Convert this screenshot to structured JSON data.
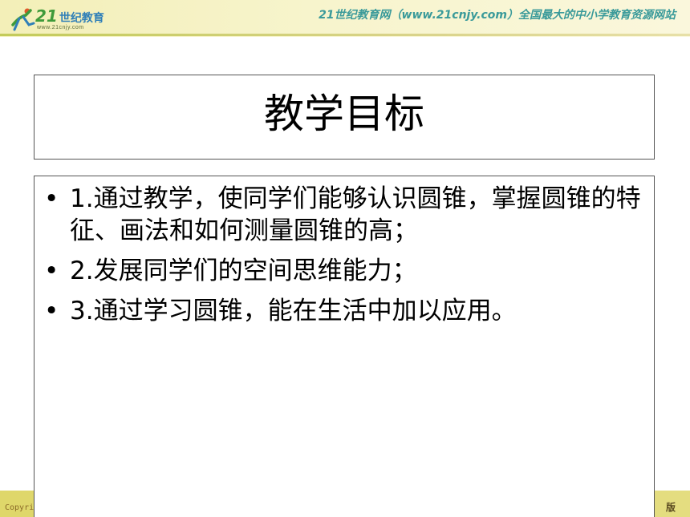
{
  "header": {
    "logo_text": "21",
    "logo_text_cn": "世纪教育",
    "logo_subtext": "www.21cnjy.com",
    "tagline": "21世纪教育网（www.21cnjy.com）全国最大的中小学教育资源网站"
  },
  "slide": {
    "title": "教学目标",
    "bullets": [
      "1.通过教学，使同学们能够认识圆锥，掌握圆锥的特征、画法和如何测量圆锥的高；",
      "2.发展同学们的空间思维能力；",
      "3.通过学习圆锥，能在生活中加以应用。"
    ]
  },
  "footer": {
    "left_text": "Copyri",
    "right_text": "版"
  },
  "colors": {
    "header_bg": "#f7f4cc",
    "footer_bg": "#e4dd80",
    "tagline": "#3a9a9a",
    "logo_green": "#3f9a3a"
  },
  "icons": {
    "logo": "runner-logo-icon",
    "bullet": "bullet-dot-icon"
  }
}
